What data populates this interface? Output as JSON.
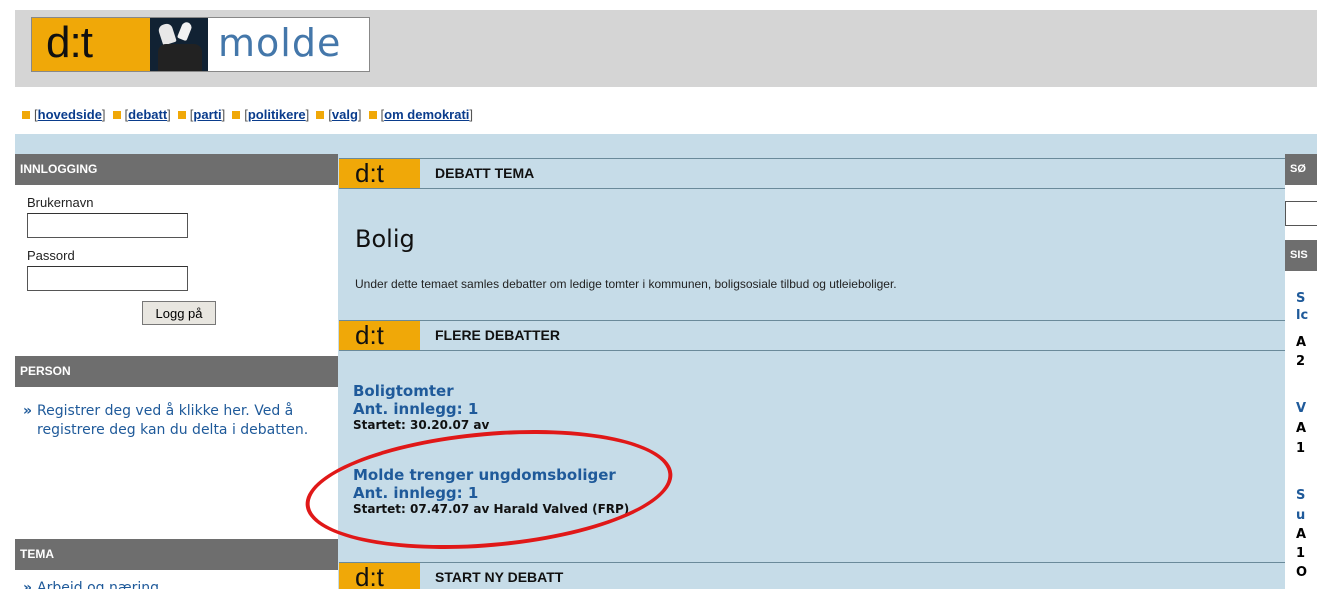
{
  "logo": {
    "mark": "d:t",
    "name": "molde"
  },
  "nav": {
    "items": [
      "hovedside",
      "debatt",
      "parti",
      "politikere",
      "valg",
      "om demokrati"
    ]
  },
  "login": {
    "header": "INNLOGGING",
    "username_label": "Brukernavn",
    "password_label": "Passord",
    "button": "Logg på"
  },
  "person": {
    "header": "PERSON",
    "text": "Registrer deg ved å klikke her. Ved å registrere deg kan du delta i debatten."
  },
  "tema": {
    "header": "TEMA",
    "items": [
      "Arbeid og næring"
    ]
  },
  "debatt_tema": {
    "header": "DEBATT TEMA",
    "title": "Bolig",
    "description": "Under dette temaet samles debatter om ledige tomter i kommunen, boligsosiale tilbud og utleieboliger."
  },
  "flere_debatter": {
    "header": "FLERE DEBATTER",
    "items": [
      {
        "title": "Boligtomter",
        "count": "Ant. innlegg: 1",
        "meta": "Startet: 30.20.07 av"
      },
      {
        "title": "Molde trenger ungdomsboliger",
        "count": "Ant. innlegg: 1",
        "meta": "Startet: 07.47.07 av Harald Valved (FRP)"
      }
    ]
  },
  "start_ny": {
    "header": "START NY DEBATT"
  },
  "right_panel": {
    "header1": "SØ",
    "header2": "SIS",
    "fragments": [
      "S",
      "lc",
      "A",
      "2",
      "V",
      "A",
      "1",
      "S",
      "u",
      "A",
      "1",
      "O"
    ]
  },
  "colors": {
    "accent": "#f0a808",
    "band": "#c6dce8",
    "link": "#1f5a9a",
    "annotation": "#e01818"
  }
}
